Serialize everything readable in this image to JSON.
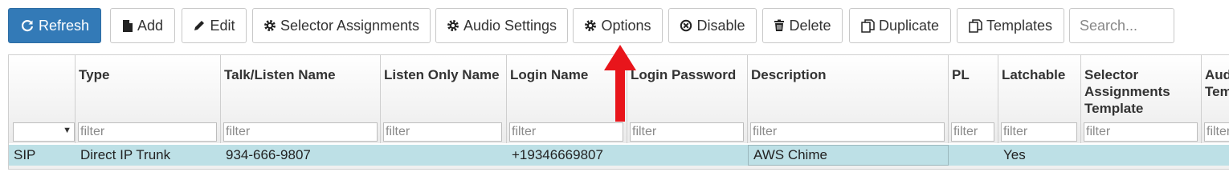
{
  "toolbar": {
    "refresh": "Refresh",
    "add": "Add",
    "edit": "Edit",
    "selector_assignments": "Selector Assignments",
    "audio_settings": "Audio Settings",
    "options": "Options",
    "disable": "Disable",
    "delete": "Delete",
    "duplicate": "Duplicate",
    "templates": "Templates",
    "search_placeholder": "Search..."
  },
  "table": {
    "columns": [
      {
        "label": ""
      },
      {
        "label": "Type"
      },
      {
        "label": "Talk/Listen Name"
      },
      {
        "label": "Listen Only Name"
      },
      {
        "label": "Login Name"
      },
      {
        "label": "Login Password"
      },
      {
        "label": "Description"
      },
      {
        "label": "PL"
      },
      {
        "label": "Latchable"
      },
      {
        "label": "Selector Assignments Template"
      },
      {
        "label": "Audio Templ"
      }
    ],
    "filter_placeholder": "filter",
    "rows": [
      {
        "protocol": "SIP",
        "type": "Direct IP Trunk",
        "talk_listen_name": "934-666-9807",
        "listen_only_name": "",
        "login_name": "+19346669807",
        "login_password": "",
        "description": "AWS Chime",
        "pl": "",
        "latchable": "Yes",
        "selector_template": "",
        "audio_template": ""
      }
    ]
  },
  "annotation": {
    "color": "#e8151b"
  },
  "colors": {
    "primary": "#337ab7",
    "selected_row": "#bde0e6"
  }
}
